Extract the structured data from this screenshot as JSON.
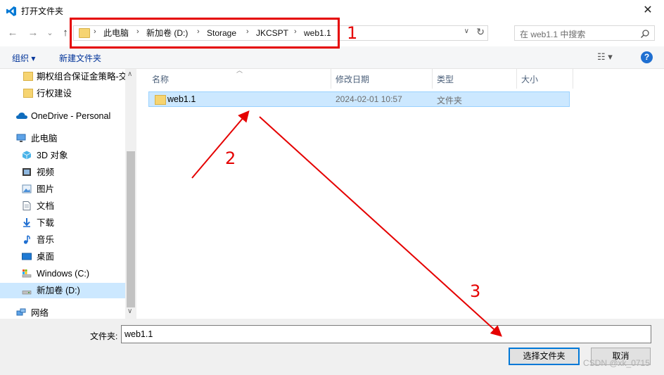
{
  "window": {
    "title": "打开文件夹",
    "close_glyph": "✕"
  },
  "nav": {
    "back_glyph": "←",
    "forward_glyph": "→",
    "recent_glyph": "⌄",
    "up_glyph": "↑",
    "breadcrumb": [
      "此电脑",
      "新加卷 (D:)",
      "Storage",
      "JKCSPT",
      "web1.1"
    ],
    "separator": "›",
    "search_placeholder": "在 web1.1 中搜索"
  },
  "toolbar": {
    "organize": "组织 ▾",
    "new_folder": "新建文件夹",
    "help": "?"
  },
  "sidebar": {
    "items": [
      {
        "label": "期权组合保证金策略-交",
        "icon": "folder-icon"
      },
      {
        "label": "行权建设",
        "icon": "folder-icon"
      },
      {
        "label": "OneDrive - Personal",
        "icon": "cloud-icon"
      },
      {
        "label": "此电脑",
        "icon": "computer-icon"
      },
      {
        "label": "3D 对象",
        "icon": "cube-icon"
      },
      {
        "label": "视频",
        "icon": "video-icon"
      },
      {
        "label": "图片",
        "icon": "picture-icon"
      },
      {
        "label": "文档",
        "icon": "document-icon"
      },
      {
        "label": "下载",
        "icon": "download-icon"
      },
      {
        "label": "音乐",
        "icon": "music-icon"
      },
      {
        "label": "桌面",
        "icon": "desktop-icon"
      },
      {
        "label": "Windows (C:)",
        "icon": "drive-icon"
      },
      {
        "label": "新加卷 (D:)",
        "icon": "drive-icon"
      },
      {
        "label": "网络",
        "icon": "network-icon"
      }
    ]
  },
  "columns": [
    "名称",
    "修改日期",
    "类型",
    "大小"
  ],
  "rows": [
    {
      "name": "web1.1",
      "modified": "2024-02-01 10:57",
      "type": "文件夹",
      "size": ""
    }
  ],
  "footer": {
    "folder_label": "文件夹:",
    "folder_value": "web1.1",
    "select_button": "选择文件夹",
    "cancel_button": "取消"
  },
  "annotations": {
    "n1": "1",
    "n2": "2",
    "n3": "3",
    "color": "#e50000"
  },
  "watermark": "CSDN @xk_0715"
}
